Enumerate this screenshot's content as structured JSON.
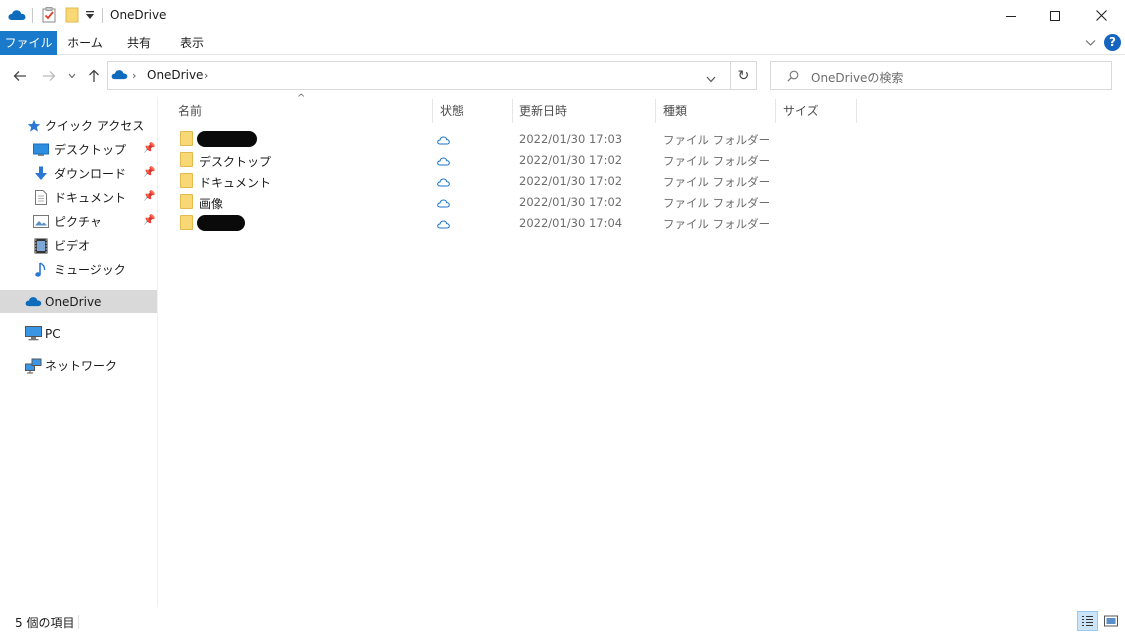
{
  "window": {
    "title": "OneDrive",
    "controls": [
      "minimize-icon",
      "maximize-icon",
      "close-icon"
    ]
  },
  "ribbon": {
    "tabs": [
      "ファイル",
      "ホーム",
      "共有",
      "表示"
    ]
  },
  "nav": {
    "breadcrumb": [
      "OneDrive"
    ],
    "search_placeholder": "OneDriveの検索"
  },
  "sidebar": {
    "quick_access": "クイック アクセス",
    "items": [
      {
        "label": "デスクトップ",
        "icon": "desktop-icon",
        "pinned": true
      },
      {
        "label": "ダウンロード",
        "icon": "download-icon",
        "pinned": true
      },
      {
        "label": "ドキュメント",
        "icon": "document-icon",
        "pinned": true
      },
      {
        "label": "ピクチャ",
        "icon": "pictures-icon",
        "pinned": true
      },
      {
        "label": "ビデオ",
        "icon": "video-icon",
        "pinned": false
      },
      {
        "label": "ミュージック",
        "icon": "music-icon",
        "pinned": false
      }
    ],
    "onedrive": "OneDrive",
    "pc": "PC",
    "network": "ネットワーク"
  },
  "columns": [
    "名前",
    "状態",
    "更新日時",
    "種類",
    "サイズ"
  ],
  "files": [
    {
      "name": "",
      "redacted": true,
      "status": "cloud-icon",
      "modified": "2022/01/30 17:03",
      "type": "ファイル フォルダー"
    },
    {
      "name": "デスクトップ",
      "redacted": false,
      "status": "cloud-icon",
      "modified": "2022/01/30 17:02",
      "type": "ファイル フォルダー"
    },
    {
      "name": "ドキュメント",
      "redacted": false,
      "status": "cloud-icon",
      "modified": "2022/01/30 17:02",
      "type": "ファイル フォルダー"
    },
    {
      "name": "画像",
      "redacted": false,
      "status": "cloud-icon",
      "modified": "2022/01/30 17:02",
      "type": "ファイル フォルダー"
    },
    {
      "name": "",
      "redacted": true,
      "status": "cloud-icon",
      "modified": "2022/01/30 17:04",
      "type": "ファイル フォルダー"
    }
  ],
  "status": {
    "item_count": "5 個の項目"
  },
  "colors": {
    "accent": "#1979ca",
    "onedrive": "#0f6cbd",
    "selected_row": "#d9d9d9",
    "help": "#1565c0"
  }
}
